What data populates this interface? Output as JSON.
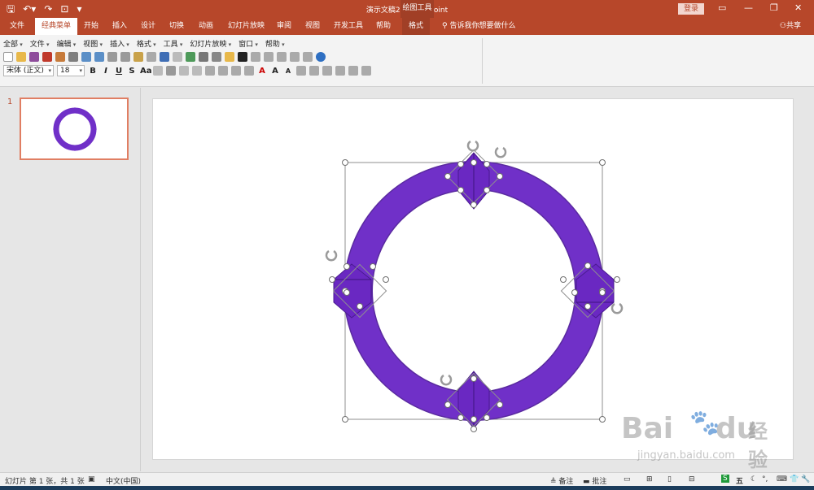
{
  "titlebar": {
    "title": "演示文稿2 - PowerPoint",
    "contextual_group": "绘图工具",
    "login": "登录",
    "qat_icons": [
      "save-icon",
      "undo-icon",
      "redo-icon",
      "start-from-beginning-icon",
      "customize-icon"
    ]
  },
  "tabs": {
    "file": "文件",
    "classic": "经典菜单",
    "home": "开始",
    "insert": "插入",
    "design": "设计",
    "transitions": "切换",
    "animations": "动画",
    "slideshow": "幻灯片放映",
    "review": "审阅",
    "view": "视图",
    "developer": "开发工具",
    "help": "帮助",
    "format": "格式",
    "tell_me": "告诉我你想要做什么",
    "share": "共享"
  },
  "menus": [
    "全部",
    "文件",
    "编辑",
    "视图",
    "插入",
    "格式",
    "工具",
    "幻灯片放映",
    "窗口",
    "帮助"
  ],
  "font": {
    "name": "宋体 (正文)",
    "size": "18"
  },
  "slides": {
    "current_number": "1"
  },
  "status": {
    "slide_info": "幻灯片 第 1 张，共 1 张",
    "language": "中文(中国)",
    "notes": "备注",
    "comments": "批注",
    "ime": "五"
  },
  "watermark": {
    "brand": "Bai",
    "brand2": "du",
    "cn": "经验",
    "url": "jingyan.baidu.com"
  },
  "colors": {
    "accent": "#b7472a",
    "shape_fill": "#7030c8",
    "shape_outline": "#5a2aa0"
  }
}
